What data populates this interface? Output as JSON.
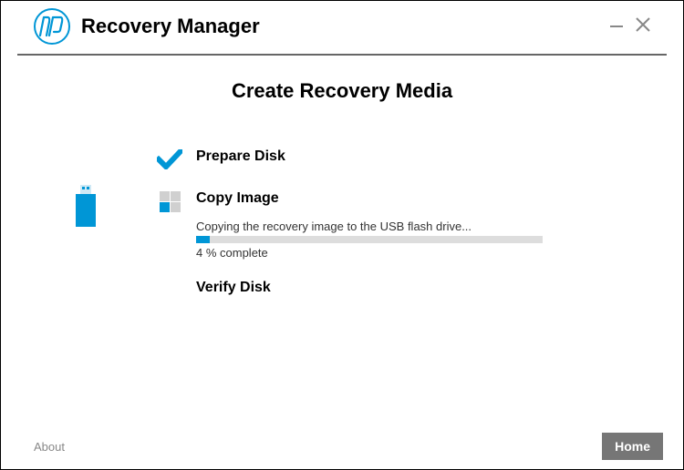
{
  "header": {
    "app_title": "Recovery Manager"
  },
  "page": {
    "title": "Create Recovery Media"
  },
  "steps": {
    "prepare": {
      "label": "Prepare Disk"
    },
    "copy": {
      "label": "Copy Image",
      "status": "Copying the recovery image to the USB flash drive...",
      "progress_pct": 4,
      "progress_text": "4 % complete"
    },
    "verify": {
      "label": "Verify Disk"
    }
  },
  "footer": {
    "about": "About",
    "home": "Home"
  },
  "colors": {
    "accent": "#0096d6"
  }
}
